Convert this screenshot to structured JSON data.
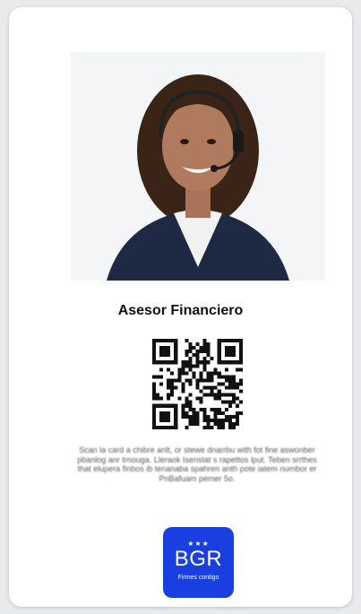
{
  "card": {
    "title": "Asesor Financiero",
    "instructions": "Scan la card a chibre anlt, or stewe dnarrbu with fot fine aswonber pbanlog anr trnouga. Lleraok Isenstat s rapettos lput. Teben srrthes that elupera finbos ib tenanaba spahren anth pote iatem numbor er PnBafuam pemer 5o.",
    "photo_alt": "advisor-portrait"
  },
  "logo": {
    "stars": "★★★",
    "name": "BGR",
    "tagline": "Firmes contigo",
    "color": "#1a3fe0"
  }
}
